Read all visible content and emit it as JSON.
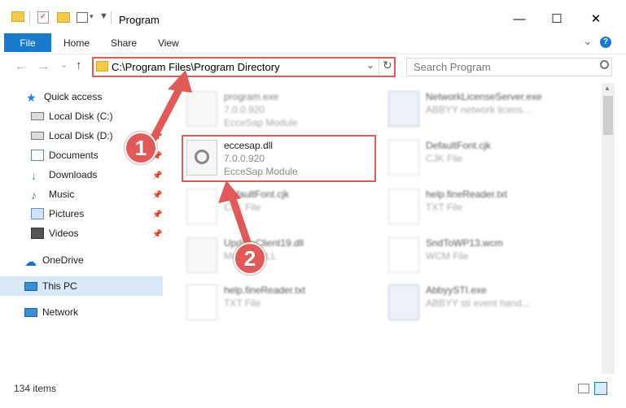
{
  "window": {
    "title": "Program",
    "minimize_glyph": "—",
    "maximize_glyph": "☐",
    "close_glyph": "✕"
  },
  "ribbon": {
    "tabs": [
      "File",
      "Home",
      "Share",
      "View"
    ],
    "expand_glyph": "⌄",
    "help_glyph": "?"
  },
  "address": {
    "path": "C:\\Program Files\\Program Directory",
    "back_glyph": "←",
    "forward_glyph": "→",
    "history_glyph": "⌄",
    "up_glyph": "↑",
    "refresh_glyph": "↻",
    "dropdown_glyph": "⌄"
  },
  "search": {
    "placeholder": "Search Program"
  },
  "sidebar": {
    "items": [
      {
        "label": "Quick access",
        "icon": "star-icon",
        "pinned": false
      },
      {
        "label": "Local Disk (C:)",
        "icon": "drive-icon",
        "pinned": false
      },
      {
        "label": "Local Disk (D:)",
        "icon": "drive-icon",
        "pinned": true
      },
      {
        "label": "Documents",
        "icon": "documents-icon",
        "pinned": true
      },
      {
        "label": "Downloads",
        "icon": "downloads-icon",
        "pinned": true
      },
      {
        "label": "Music",
        "icon": "music-icon",
        "pinned": true
      },
      {
        "label": "Pictures",
        "icon": "pictures-icon",
        "pinned": true
      },
      {
        "label": "Videos",
        "icon": "videos-icon",
        "pinned": true
      },
      {
        "label": "OneDrive",
        "icon": "onedrive-icon",
        "pinned": false
      },
      {
        "label": "This PC",
        "icon": "pc-icon",
        "pinned": false
      },
      {
        "label": "Network",
        "icon": "network-icon",
        "pinned": false
      }
    ],
    "pin_glyph": "📌"
  },
  "files": {
    "left": [
      {
        "name": "program.exe",
        "line2": "7.0.0.920",
        "line3": "EcceSap Module"
      },
      {
        "name": "eccesap.dll",
        "line2": "7.0.0.920",
        "line3": "EcceSap Module"
      },
      {
        "name": "DefaultFont.cjk",
        "line2": "CJK File",
        "line3": ""
      },
      {
        "name": "UpdateClient19.dll",
        "line2": "Module DLL",
        "line3": ""
      },
      {
        "name": "help.fineReader.txt",
        "line2": "TXT File",
        "line3": ""
      }
    ],
    "right": [
      {
        "name": "NetworkLicenseServer.exe",
        "line2": "ABBYY network licens...",
        "line3": ""
      },
      {
        "name": "DefaultFont.cjk",
        "line2": "CJK File",
        "line3": ""
      },
      {
        "name": "help.fineReader.txt",
        "line2": "TXT File",
        "line3": ""
      },
      {
        "name": "SndToWP13.wcm",
        "line2": "WCM File",
        "line3": ""
      },
      {
        "name": "AbbyySTI.exe",
        "line2": "ABBYY sti event hand...",
        "line3": ""
      }
    ]
  },
  "status": {
    "items": "134 items"
  },
  "annotations": {
    "step1": "1",
    "step2": "2"
  },
  "colors": {
    "accent": "#1979ca",
    "highlight": "#e05a5a",
    "selection": "#d9e9f7"
  }
}
